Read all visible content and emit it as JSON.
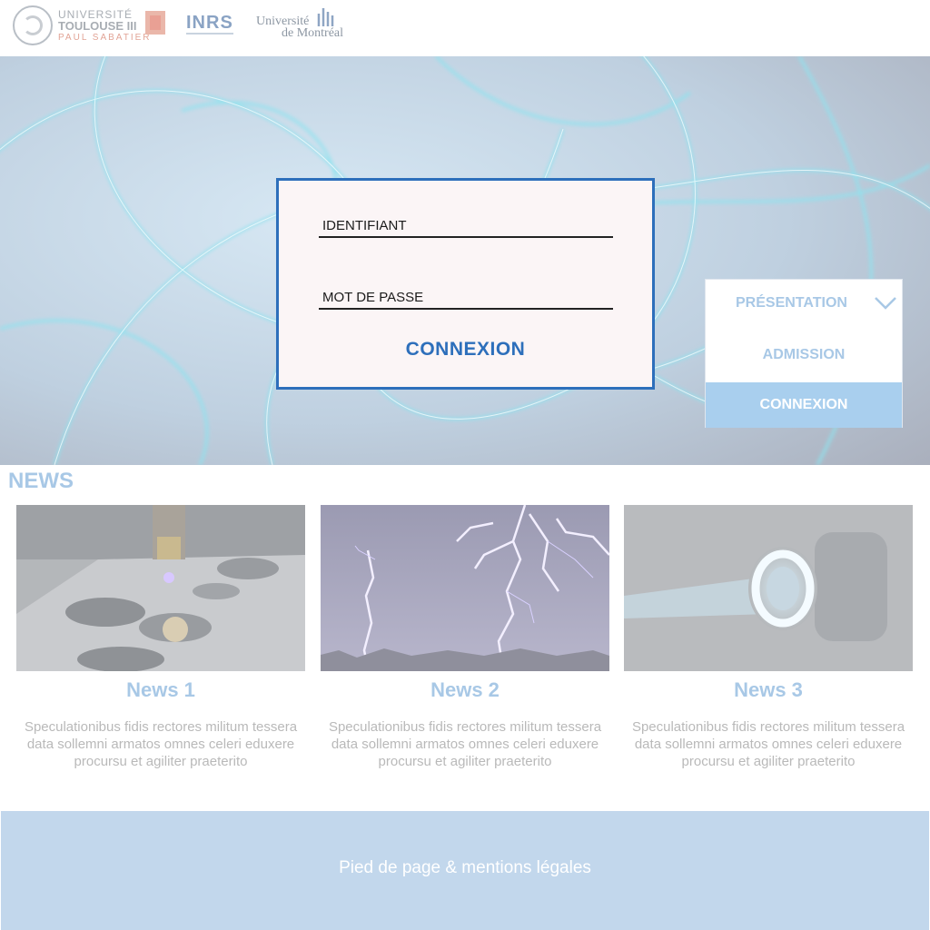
{
  "header": {
    "logos": {
      "ut3_line1": "UNIVERSITÉ",
      "ut3_line2": "TOULOUSE III",
      "ut3_line3": "PAUL SABATIER",
      "inrs": "INRS",
      "udem_line1": "Université",
      "udem_line2": "de Montréal"
    }
  },
  "login": {
    "identifiant_placeholder": "IDENTIFIANT",
    "password_placeholder": "MOT DE PASSE",
    "submit_label": "CONNEXION"
  },
  "menu": {
    "items": [
      {
        "label": "PRÉSENTATION",
        "icon": "chevron-down-icon"
      },
      {
        "label": "ADMISSION"
      },
      {
        "label": "CONNEXION",
        "active": true
      }
    ]
  },
  "news": {
    "title": "NEWS",
    "items": [
      {
        "title": "News 1",
        "text": "Speculationibus fidis rectores militum tessera data sollemni armatos omnes celeri eduxere procursu et agiliter praeterito"
      },
      {
        "title": "News 2",
        "text": "Speculationibus fidis rectores militum tessera data sollemni armatos omnes celeri eduxere procursu et agiliter praeterito"
      },
      {
        "title": "News 3",
        "text": "Speculationibus fidis rectores militum tessera data sollemni armatos omnes celeri eduxere procursu et agiliter praeterito"
      }
    ]
  },
  "footer": {
    "text": "Pied de page & mentions légales"
  },
  "colors": {
    "accent_blue": "#2d6fbb",
    "light_blue": "#a8c8e6",
    "footer_bg": "#c2d7ec"
  }
}
